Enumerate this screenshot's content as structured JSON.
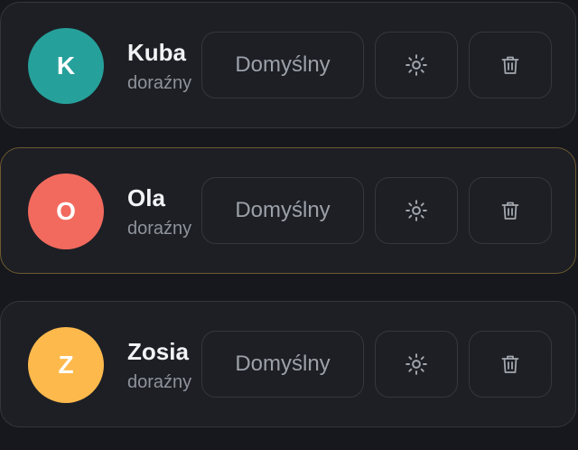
{
  "profiles": [
    {
      "initial": "K",
      "name": "Kuba",
      "subtitle": "doraźny",
      "avatar_color": "#26a09a",
      "default_label": "Domyślny",
      "selected": false
    },
    {
      "initial": "O",
      "name": "Ola",
      "subtitle": "doraźny",
      "avatar_color": "#f26a5e",
      "default_label": "Domyślny",
      "selected": true
    },
    {
      "initial": "Z",
      "name": "Zosia",
      "subtitle": "doraźny",
      "avatar_color": "#fdb94c",
      "default_label": "Domyślny",
      "selected": false
    }
  ],
  "icons": {
    "settings": "sun-gear-icon",
    "delete": "trash-icon"
  },
  "colors": {
    "background": "#16181d",
    "card": "#1d1f25",
    "card_border": "#33363d",
    "selected_border": "#6d5a2e"
  }
}
